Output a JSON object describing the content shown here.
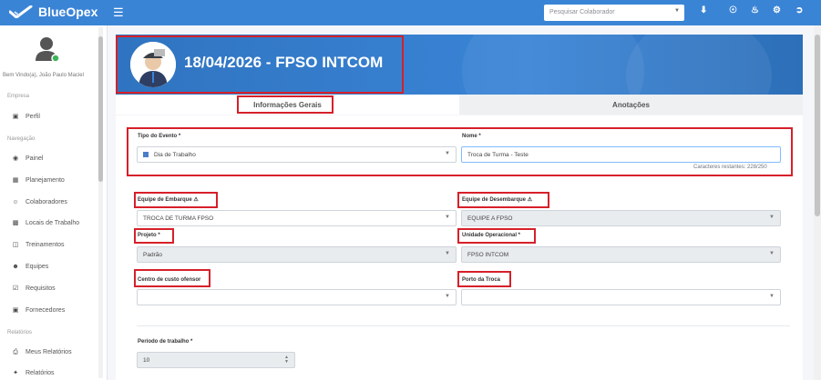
{
  "app": {
    "name": "BlueOpex"
  },
  "topbar": {
    "search_placeholder": "Pesquisar Colaborador",
    "icons": [
      "download-icon",
      "headset-icon",
      "bell-icon",
      "gear-icon",
      "logout-icon"
    ]
  },
  "sidebar": {
    "welcome": "Bem Vindo(a), João Paulo Maciel",
    "sections": {
      "empresa": "Empresa",
      "navegacao": "Navegação",
      "relatorios": "Relatórios"
    },
    "items": {
      "perfil": "Perfil",
      "painel": "Painel",
      "planejamento": "Planejamento",
      "colaboradores": "Colaboradores",
      "locais": "Locais de Trabalho",
      "treinamentos": "Treinamentos",
      "equipes": "Equipes",
      "requisitos": "Requisitos",
      "fornecedores": "Fornecedores",
      "meus_relatorios": "Meus Relatórios",
      "relatorios": "Relatórios"
    }
  },
  "banner": {
    "title": "18/04/2026 - FPSO INTCOM"
  },
  "tabs": {
    "general": "Informações Gerais",
    "notes": "Anotações"
  },
  "form": {
    "tipo_evento": {
      "label": "Tipo do Evento *",
      "value": "Dia de Trabalho"
    },
    "nome": {
      "label": "Nome *",
      "value": "Troca de Turma - Teste",
      "counter": "Caracteres restantes: 228/250"
    },
    "equipe_embarque": {
      "label": "Equipe de Embarque",
      "value": "TROCA DE TURMA FPSO"
    },
    "equipe_desembarque": {
      "label": "Equipe de Desembarque",
      "value": "EQUIPE A FPSO"
    },
    "projeto": {
      "label": "Projeto *",
      "value": "Padrão"
    },
    "unidade": {
      "label": "Unidade Operacional *",
      "value": "FPSO INTCOM"
    },
    "centro_custo": {
      "label": "Centro de custo ofensor",
      "value": ""
    },
    "porto": {
      "label": "Porto da Troca",
      "value": ""
    },
    "periodo": {
      "label": "Período de trabalho *",
      "value": "10"
    }
  },
  "colors": {
    "accent": "#3a84d6",
    "highlight": "#d6202a"
  }
}
